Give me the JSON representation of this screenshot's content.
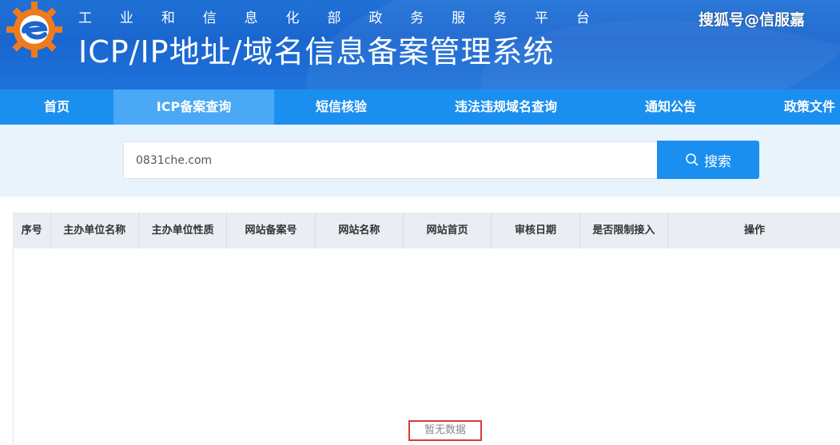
{
  "header": {
    "subtitle_chars": [
      "工",
      "业",
      "和",
      "信",
      "息",
      "化",
      "部",
      "政",
      "务",
      "服",
      "务",
      "平",
      "台"
    ],
    "title": "ICP/IP地址/域名信息备案管理系统",
    "watermark": "搜狐号@信服嘉"
  },
  "nav": {
    "items": [
      {
        "label": "首页"
      },
      {
        "label": "ICP备案查询"
      },
      {
        "label": "短信核验"
      },
      {
        "label": "违法违规域名查询"
      },
      {
        "label": "通知公告"
      },
      {
        "label": "政策文件"
      }
    ],
    "active": "ICP备案查询"
  },
  "search": {
    "value": "0831che.com",
    "button_label": "搜索",
    "button_icon": "search-icon"
  },
  "table": {
    "columns": [
      "序号",
      "主办单位名称",
      "主办单位性质",
      "网站备案号",
      "网站名称",
      "网站首页",
      "审核日期",
      "是否限制接入",
      "操作"
    ],
    "empty_text": "暂无数据"
  },
  "colors": {
    "header_blue": "#1a66cf",
    "nav_blue": "#1b8ff0",
    "nav_active": "#4ba8f5",
    "search_band": "#e9f3fb",
    "table_head": "#eaedf3",
    "highlight_red": "#d93a3a",
    "logo_orange": "#f07a1e"
  }
}
